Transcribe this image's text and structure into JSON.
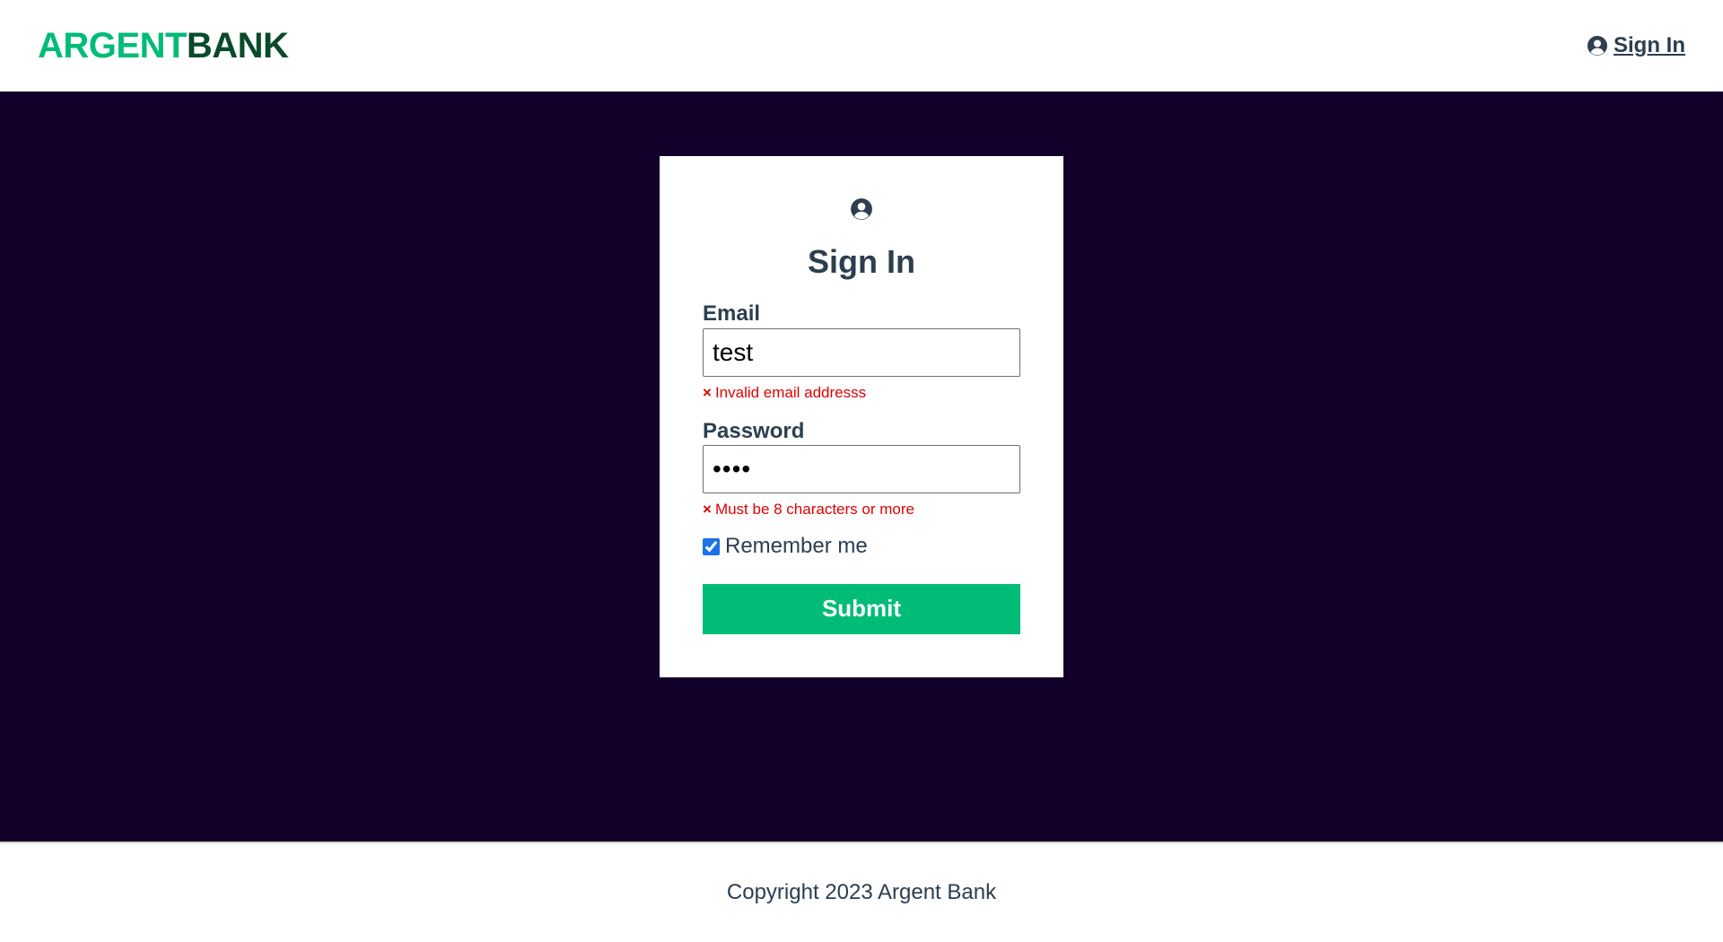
{
  "header": {
    "logo_part1": "ARGENT",
    "logo_part2": "BANK",
    "signin_link": "Sign In"
  },
  "form": {
    "title": "Sign In",
    "email": {
      "label": "Email",
      "value": "test",
      "error": "Invalid email addresss"
    },
    "password": {
      "label": "Password",
      "value": "test",
      "error": "Must be 8 characters or more"
    },
    "remember": {
      "label": "Remember me",
      "checked": true
    },
    "submit_label": "Submit",
    "error_marker": "×"
  },
  "footer": {
    "text": "Copyright 2023 Argent Bank"
  },
  "icons": {
    "nav_user": "user-circle-icon",
    "card_user": "user-circle-icon"
  },
  "colors": {
    "brand_green": "#00bc77",
    "brand_dark_green": "#0a4a2a",
    "main_background": "#12002b",
    "text": "#2c3e50",
    "error": "#e00000"
  }
}
